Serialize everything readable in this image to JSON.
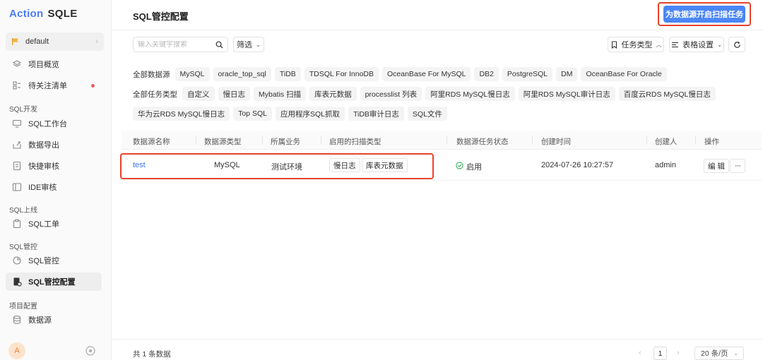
{
  "brand": {
    "prefix": "Action",
    "name": "SQLE"
  },
  "project": {
    "name": "default"
  },
  "sidebar": {
    "top_items": [
      {
        "label": "项目概览",
        "icon": "layers-icon"
      },
      {
        "label": "待关注清单",
        "icon": "checklist-icon"
      }
    ],
    "groups": [
      {
        "title": "SQL开发",
        "items": [
          {
            "label": "SQL工作台",
            "icon": "monitor-icon"
          },
          {
            "label": "数据导出",
            "icon": "export-icon"
          },
          {
            "label": "快捷审核",
            "icon": "quick-audit-icon"
          },
          {
            "label": "IDE审核",
            "icon": "ide-icon"
          }
        ]
      },
      {
        "title": "SQL上线",
        "items": [
          {
            "label": "SQL工单",
            "icon": "ticket-icon"
          }
        ]
      },
      {
        "title": "SQL管控",
        "items": [
          {
            "label": "SQL管控",
            "icon": "control-icon"
          },
          {
            "label": "SQL管控配置",
            "icon": "control-config-icon"
          }
        ]
      },
      {
        "title": "项目配置",
        "items": [
          {
            "label": "数据源",
            "icon": "database-icon"
          }
        ]
      }
    ],
    "user_initial": "A"
  },
  "header": {
    "title": "SQL管控配置",
    "primary_action": "为数据源开启扫描任务"
  },
  "toolbar": {
    "search_placeholder": "输入关键字搜索",
    "filter_label": "筛选",
    "task_type_label": "任务类型",
    "table_settings_label": "表格设置"
  },
  "filters": {
    "datasource": {
      "label": "全部数据源",
      "options": [
        "MySQL",
        "oracle_top_sql",
        "TiDB",
        "TDSQL For InnoDB",
        "OceanBase For MySQL",
        "DB2",
        "PostgreSQL",
        "DM",
        "OceanBase For Oracle"
      ]
    },
    "task_type": {
      "label": "全部任务类型",
      "options": [
        "自定义",
        "慢日志",
        "Mybatis 扫描",
        "库表元数据",
        "processlist 列表",
        "阿里RDS MySQL慢日志",
        "阿里RDS MySQL审计日志",
        "百度云RDS MySQL慢日志",
        "华为云RDS MySQL慢日志",
        "Top SQL",
        "应用程序SQL抓取",
        "TiDB审计日志",
        "SQL文件"
      ]
    }
  },
  "table": {
    "columns": [
      "数据源名称",
      "数据源类型",
      "所属业务",
      "启用的扫描类型",
      "数据源任务状态",
      "创建时间",
      "创建人",
      "操作"
    ],
    "rows": [
      {
        "name": "test",
        "type": "MySQL",
        "business": "测试环境",
        "scan_types": [
          "慢日志",
          "库表元数据"
        ],
        "status": "启用",
        "created_at": "2024-07-26 10:27:57",
        "creator": "admin",
        "edit_label": "编 辑",
        "more_label": "···"
      }
    ]
  },
  "footer": {
    "total": "共 1 条数据",
    "current_page": "1",
    "page_size": "20 条/页"
  },
  "colors": {
    "accent": "#4a86f7",
    "highlight": "#e8432b",
    "success": "#3aaa5c"
  }
}
